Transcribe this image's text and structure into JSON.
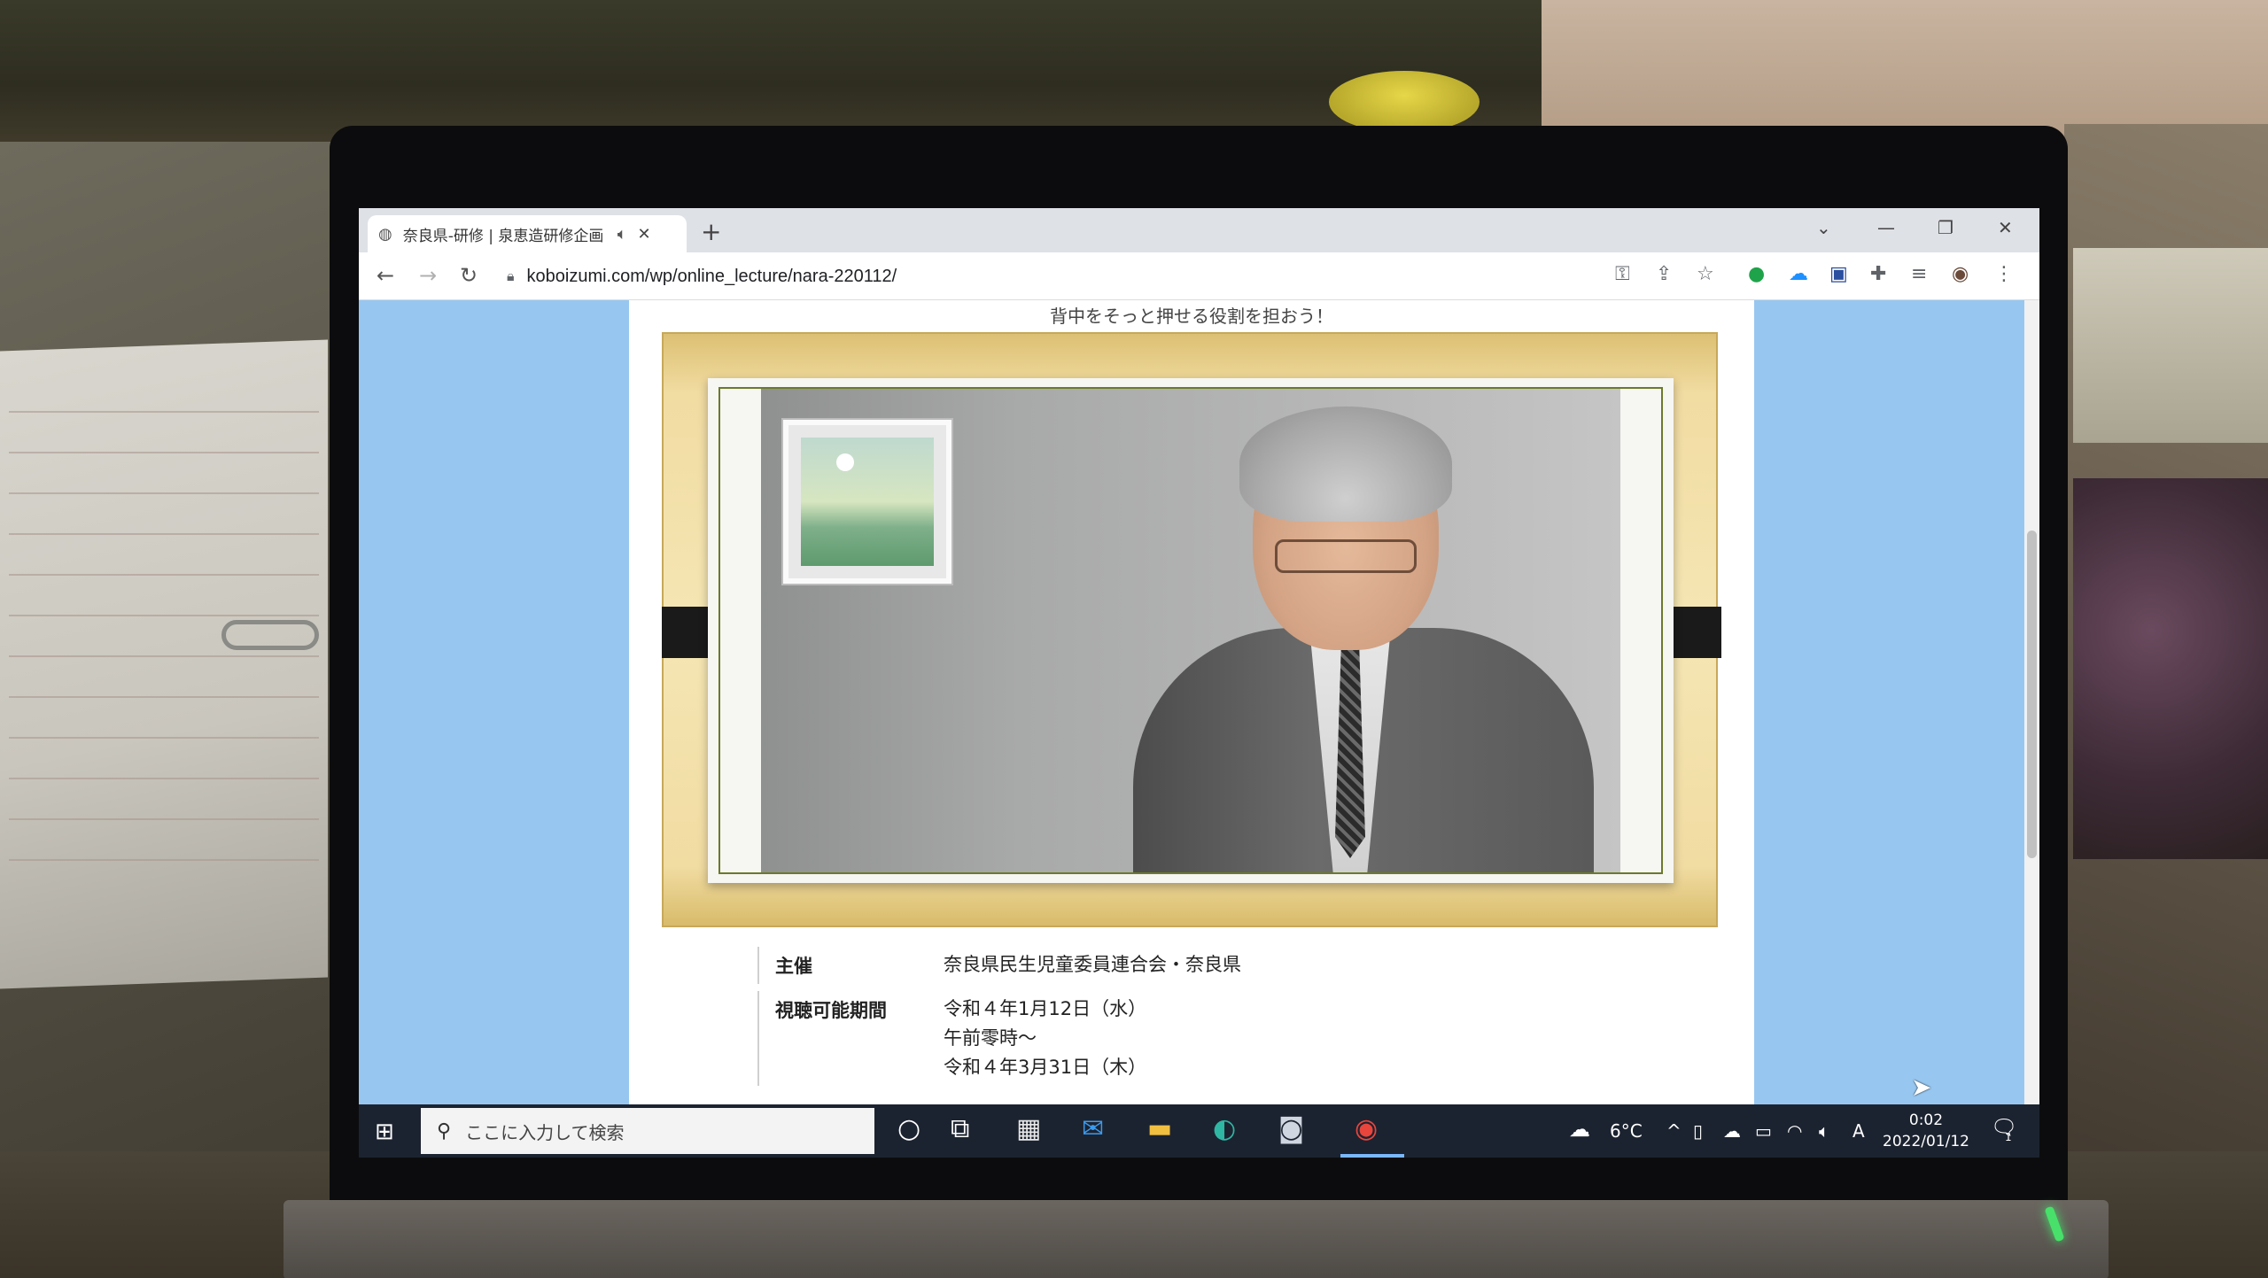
{
  "browser": {
    "tab_title": "奈良県-研修 | 泉恵造研修企画",
    "new_tab": "+",
    "url": "koboizumi.com/wp/online_lecture/nara-220112/"
  },
  "page": {
    "tagline": "背中をそっと押せる役割を担おう！",
    "info": [
      {
        "label": "主催",
        "lines": [
          "奈良県民生児童委員連合会・奈良県"
        ]
      },
      {
        "label": "視聴可能期間",
        "lines": [
          "令和４年1月12日（水）",
          "午前零時～",
          "令和４年3月31日（木）"
        ]
      }
    ]
  },
  "taskbar": {
    "search_placeholder": "ここに入力して検索",
    "weather": "6°C",
    "ime": "A",
    "time": "0:02",
    "date": "2022/01/12",
    "notifications": "1"
  },
  "icons": {
    "tab_globe": "globe-icon",
    "speaker": "speaker-icon",
    "start": "windows-start-icon",
    "chrome": "chrome-icon"
  },
  "colors": {
    "page_bg": "#97c7f0",
    "taskbar_bg": "#1c2330"
  }
}
